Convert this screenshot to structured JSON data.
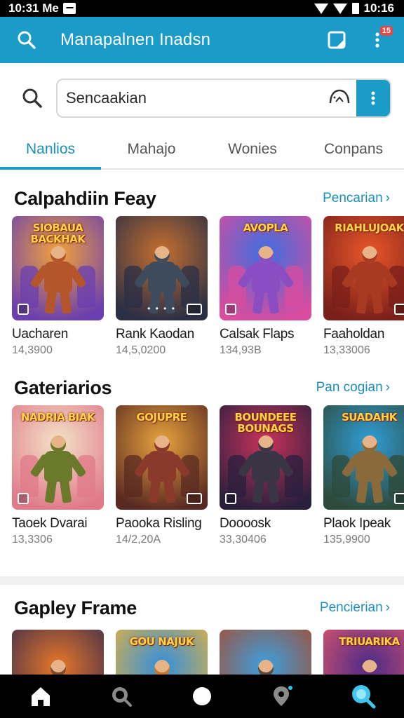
{
  "status_bar": {
    "time_left": "10:31 Me",
    "time_right": "10:16"
  },
  "app_bar": {
    "title": "Manapalnen Inadsn",
    "badge": "15"
  },
  "search": {
    "placeholder": "Sencaakian"
  },
  "tabs": [
    {
      "label": "Nanlios",
      "active": true
    },
    {
      "label": "Mahajo",
      "active": false
    },
    {
      "label": "Wonies",
      "active": false
    },
    {
      "label": "Conpans",
      "active": false
    }
  ],
  "sections": [
    {
      "title": "Calpahdiin Feay",
      "link": "Pencarian",
      "cards": [
        {
          "name": "Uacharen",
          "count": "14,3900",
          "art_title": "SIOBAUA BACKHAK",
          "colors": [
            "#f2a23a",
            "#6a3fb0"
          ],
          "figure": "#b5562a"
        },
        {
          "name": "Rank Kaodan",
          "count": "14,5,0200",
          "art_title": "",
          "colors": [
            "#c76f2f",
            "#2a2f45"
          ],
          "figure": "#3e4b5c"
        },
        {
          "name": "Calsak Flaps",
          "count": "134,93B",
          "art_title": "AVOPLA",
          "colors": [
            "#3b6fe0",
            "#d94c9e"
          ],
          "figure": "#8a4ec2"
        },
        {
          "name": "Faaholdan",
          "count": "13,33006",
          "art_title": "RIAHLUJOAK",
          "colors": [
            "#e8572a",
            "#7a1f1a"
          ],
          "figure": "#a83a22"
        }
      ]
    },
    {
      "title": "Gateriarios",
      "link": "Pan cogian",
      "cards": [
        {
          "name": "Taoek Dvarai",
          "count": "13,3306",
          "art_title": "NADRIA BIAK",
          "colors": [
            "#f3e2c8",
            "#e07a8a"
          ],
          "figure": "#6b7a2a"
        },
        {
          "name": "Paooka Risling",
          "count": "14/2,20A",
          "art_title": "GOJUPRE",
          "colors": [
            "#e8a33c",
            "#5a2a22"
          ],
          "figure": "#8a3a2a"
        },
        {
          "name": "Doooosk",
          "count": "33,30406",
          "art_title": "BOUNDEEE BOUNAGS",
          "colors": [
            "#c9335b",
            "#2a1f3d"
          ],
          "figure": "#3a3545"
        },
        {
          "name": "Plaok Ipeak",
          "count": "135,9900",
          "art_title": "SUADAHK",
          "colors": [
            "#2f9ed8",
            "#2e4a3a"
          ],
          "figure": "#8a6a3a"
        }
      ]
    },
    {
      "title": "Gapley Frame",
      "link": "Pencierian",
      "cards": [
        {
          "name": "",
          "count": "",
          "art_title": "",
          "colors": [
            "#e8772a",
            "#3a2b4a"
          ],
          "figure": "#7a4a2a"
        },
        {
          "name": "",
          "count": "",
          "art_title": "GOU NAJUK",
          "colors": [
            "#2f8fe0",
            "#e8b23a"
          ],
          "figure": "#c27a2a"
        },
        {
          "name": "",
          "count": "",
          "art_title": "",
          "colors": [
            "#3aa0e0",
            "#a84a2a"
          ],
          "figure": "#5a4a3a"
        },
        {
          "name": "",
          "count": "",
          "art_title": "TRIUARIKA",
          "colors": [
            "#4a2a8a",
            "#e0566a"
          ],
          "figure": "#6a2a7a"
        }
      ]
    }
  ]
}
